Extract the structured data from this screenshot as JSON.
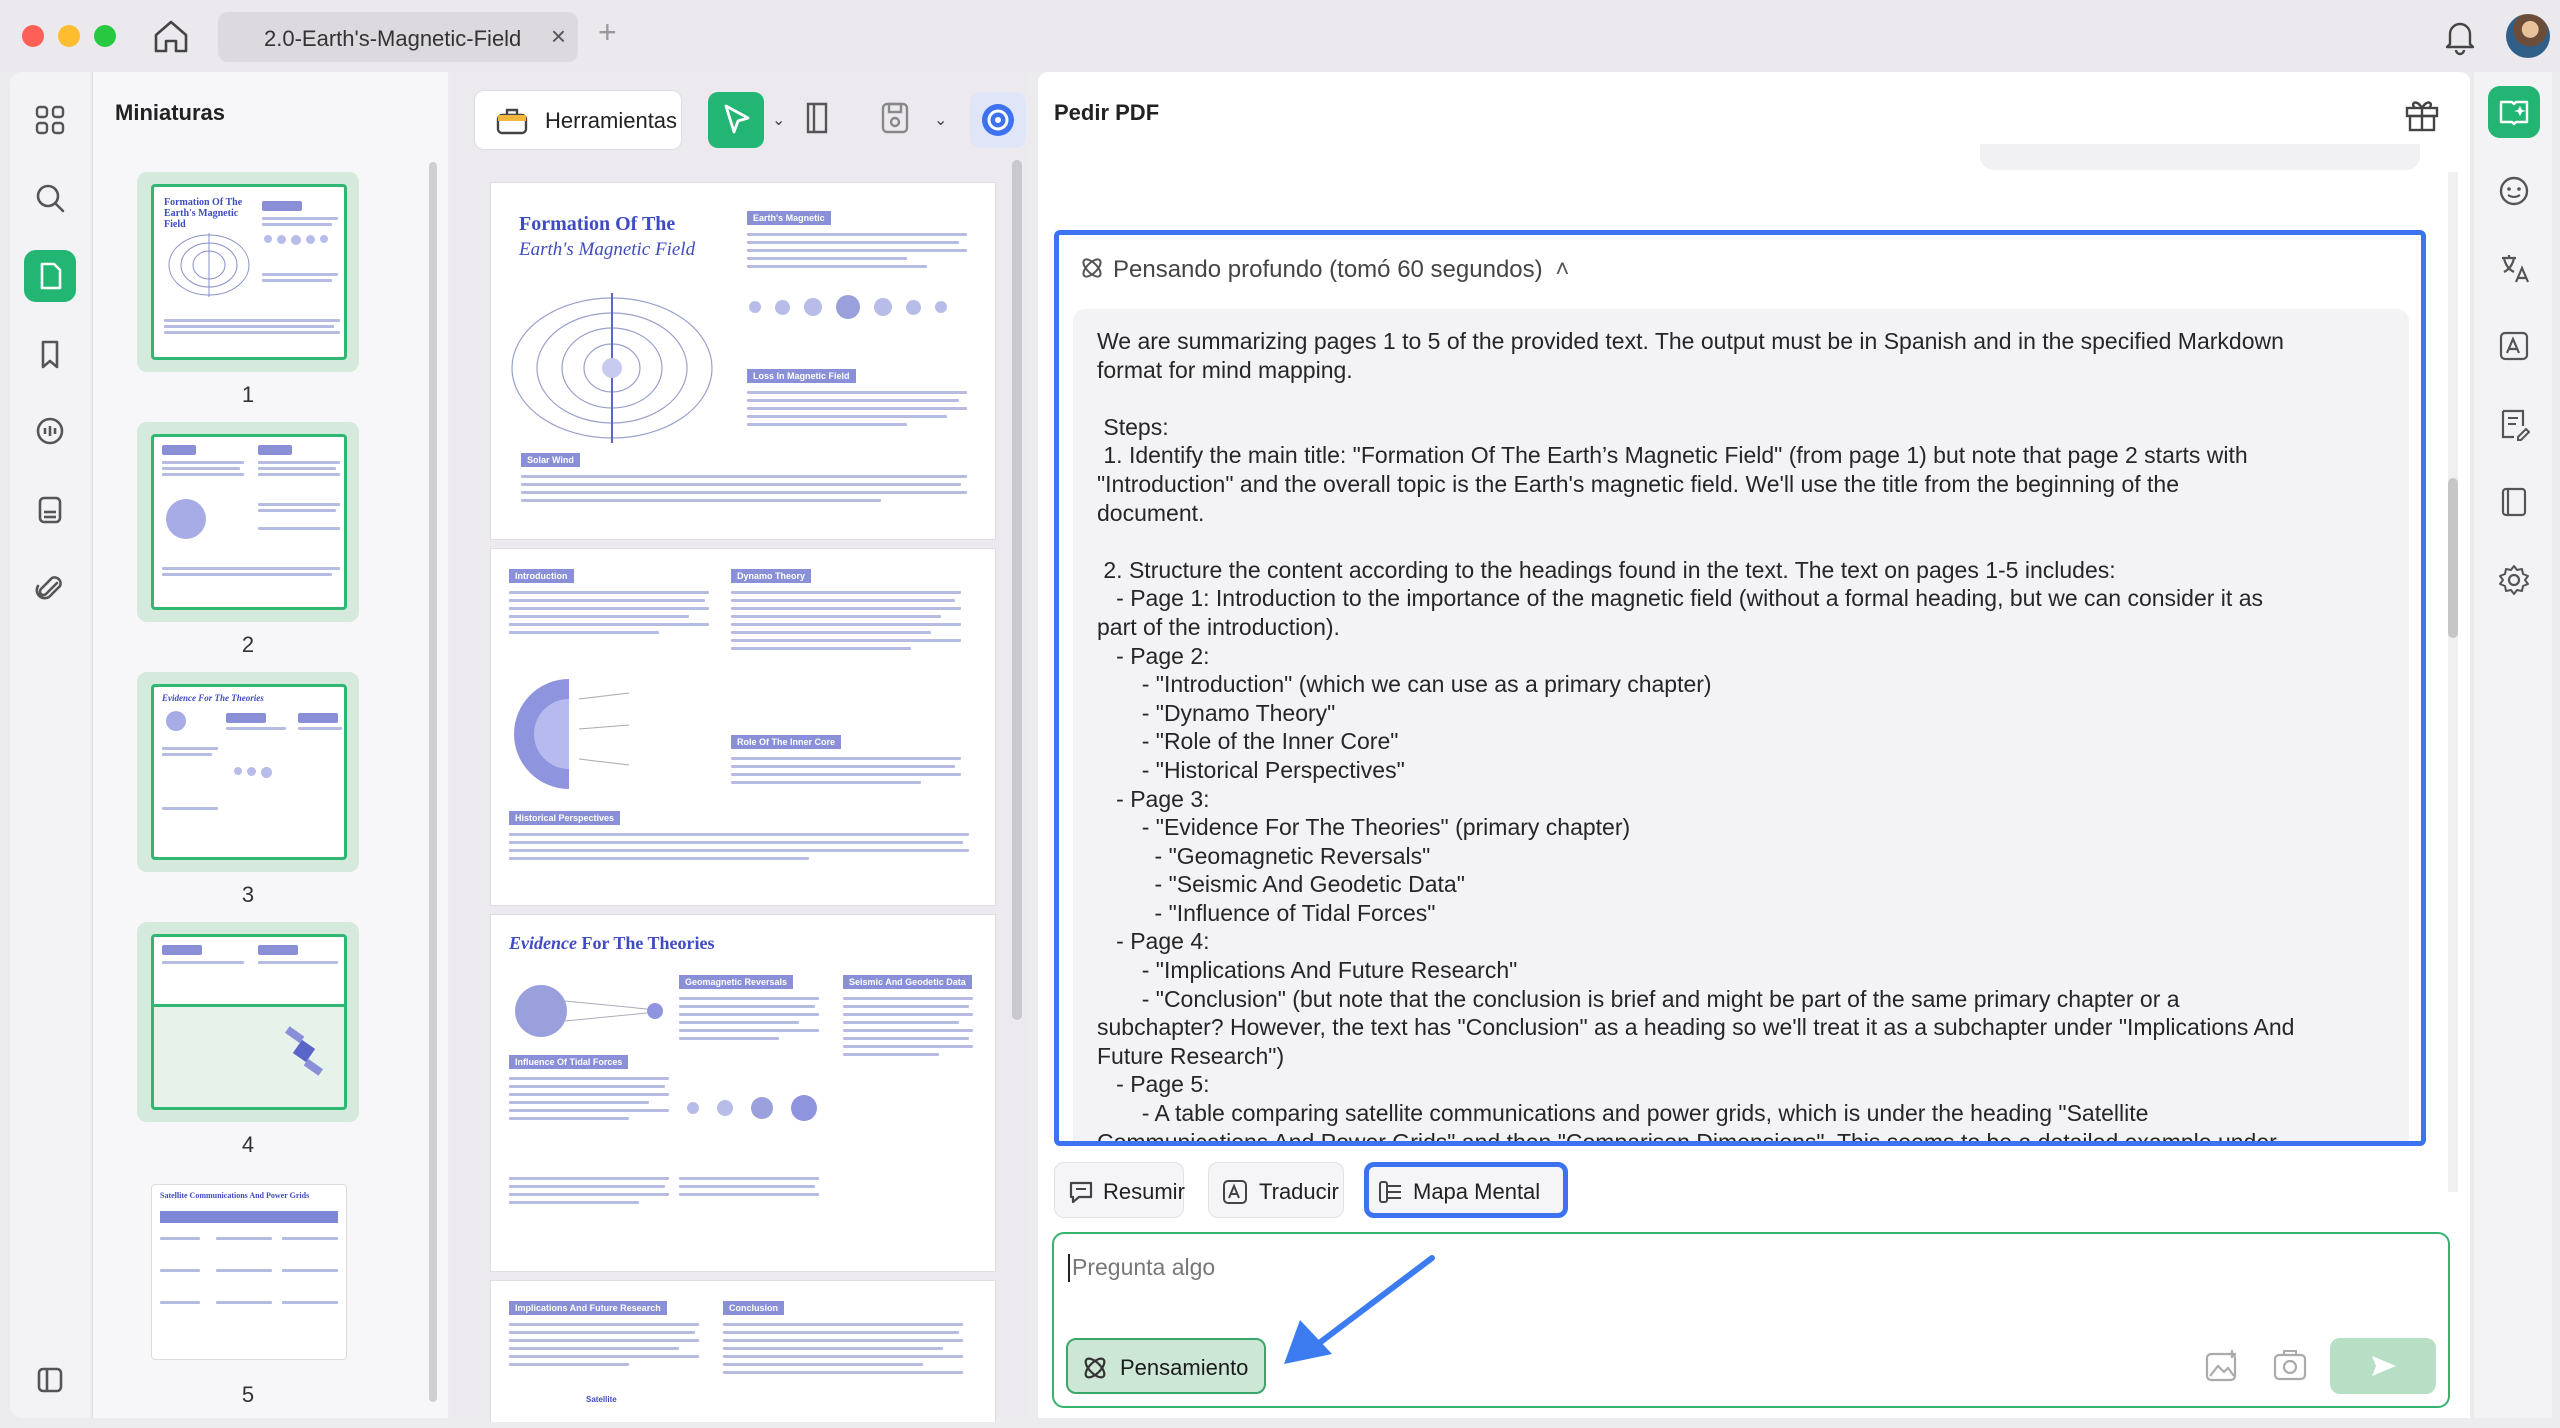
{
  "window": {
    "tab_title": "2.0-Earth's-Magnetic-Field",
    "tab_close": "×",
    "tab_add": "+"
  },
  "icons": {
    "home": "home-icon",
    "notifications": "bell-icon",
    "user": "avatar"
  },
  "left_rail": {
    "items": [
      "grid-icon",
      "search-icon",
      "pages-icon",
      "bookmark-icon",
      "comments-icon",
      "organize-icon",
      "attachment-icon"
    ],
    "active": "pages-icon",
    "bottom": "sidebar-toggle-icon"
  },
  "thumbnails": {
    "title": "Miniaturas",
    "pages": [
      {
        "number": "1",
        "title": "Formation Of The Earth's Magnetic Field",
        "selected": true
      },
      {
        "number": "2",
        "title": "",
        "selected": true
      },
      {
        "number": "3",
        "title": "Evidence For The Theories",
        "selected": true
      },
      {
        "number": "4",
        "title": "",
        "selected": true
      },
      {
        "number": "5",
        "title": "Satellite Communications And Power Grids",
        "selected": false
      }
    ]
  },
  "toolbar": {
    "tools_label": "Herramientas",
    "caret": "⌄"
  },
  "document": {
    "page1_title_line1": "Formation Of The",
    "page1_title_line2": "Earth's Magnetic Field",
    "page3_title_em": "Evidence",
    "page3_title_rest": " For The Theories",
    "page1_tags": [
      "Earth's Magnetic",
      "Solar Wind",
      "Loss In Magnetic Field"
    ],
    "page2_tags": [
      "Introduction",
      "Dynamo Theory",
      "Role Of The Inner Core",
      "Historical Perspectives"
    ],
    "page3_tags": [
      "Influence Of Tidal Forces",
      "Geomagnetic Reversals",
      "Seismic And Geodetic Data"
    ],
    "page4_tags": [
      "Implications And Future Research",
      "Conclusion"
    ],
    "page4_footer": "Satellite"
  },
  "chat": {
    "title": "Pedir PDF",
    "thinking_header": "Pensando profundo (tomó 60 segundos)",
    "thinking_caret": "˄",
    "thinking_text": "We are summarizing pages 1 to 5 of the provided text. The output must be in Spanish and in the specified Markdown\nformat for mind mapping.\n\n Steps:\n 1. Identify the main title: \"Formation Of The Earth’s Magnetic Field\" (from page 1) but note that page 2 starts with\n\"Introduction\" and the overall topic is the Earth's magnetic field. We'll use the title from the beginning of the\ndocument.\n\n 2. Structure the content according to the headings found in the text. The text on pages 1-5 includes:\n   - Page 1: Introduction to the importance of the magnetic field (without a formal heading, but we can consider it as\npart of the introduction).\n   - Page 2:\n       - \"Introduction\" (which we can use as a primary chapter)\n       - \"Dynamo Theory\"\n       - \"Role of the Inner Core\"\n       - \"Historical Perspectives\"\n   - Page 3:\n       - \"Evidence For The Theories\" (primary chapter)\n         - \"Geomagnetic Reversals\"\n         - \"Seismic And Geodetic Data\"\n         - \"Influence of Tidal Forces\"\n   - Page 4:\n       - \"Implications And Future Research\"\n       - \"Conclusion\" (but note that the conclusion is brief and might be part of the same primary chapter or a\nsubchapter? However, the text has \"Conclusion\" as a heading so we'll treat it as a subchapter under \"Implications And\nFuture Research\")\n   - Page 5:\n       - A table comparing satellite communications and power grids, which is under the heading \"Satellite\nCommunications And Power Grids\" and then \"Comparison Dimensions\". This seems to be a detailed example under",
    "actions": {
      "summarize": "Resumir",
      "translate": "Traducir",
      "mindmap": "Mapa Mental"
    },
    "input_placeholder": "Pregunta algo",
    "thinking_button": "Pensamiento"
  },
  "right_rail": {
    "items": [
      "ai-assistant-icon",
      "chat-bot-icon",
      "translate-icon",
      "grammar-icon",
      "rewrite-icon",
      "reader-icon",
      "settings-icon"
    ],
    "active": "ai-assistant-icon"
  },
  "colors": {
    "accent_green": "#22b573",
    "highlight_blue": "#3d73f0",
    "page_blue": "#3f4bc2"
  }
}
